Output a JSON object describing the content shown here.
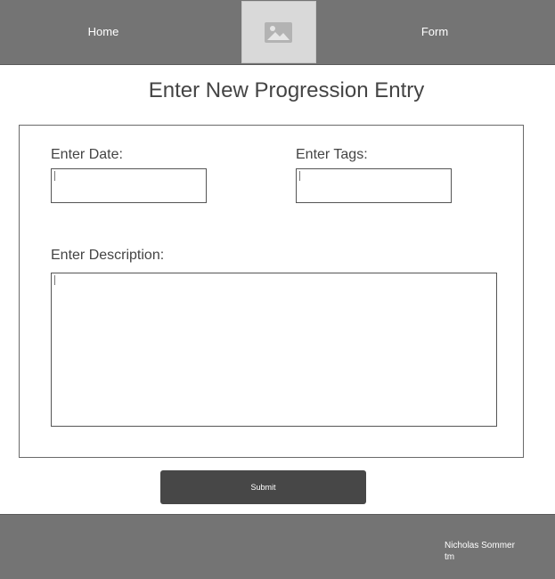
{
  "header": {
    "nav_home": "Home",
    "nav_form": "Form",
    "logo_icon": "image-placeholder-icon"
  },
  "page": {
    "title": "Enter New Progression Entry"
  },
  "form": {
    "date_label": "Enter Date:",
    "tags_label": "Enter Tags:",
    "description_label": "Enter Description:",
    "date_value": "",
    "tags_value": "",
    "description_value": "",
    "submit_label": "Submit"
  },
  "footer": {
    "author": "Nicholas Sommer",
    "mark": "tm"
  },
  "colors": {
    "header_bg": "#747474",
    "submit_bg": "#474747",
    "text": "#444444"
  }
}
